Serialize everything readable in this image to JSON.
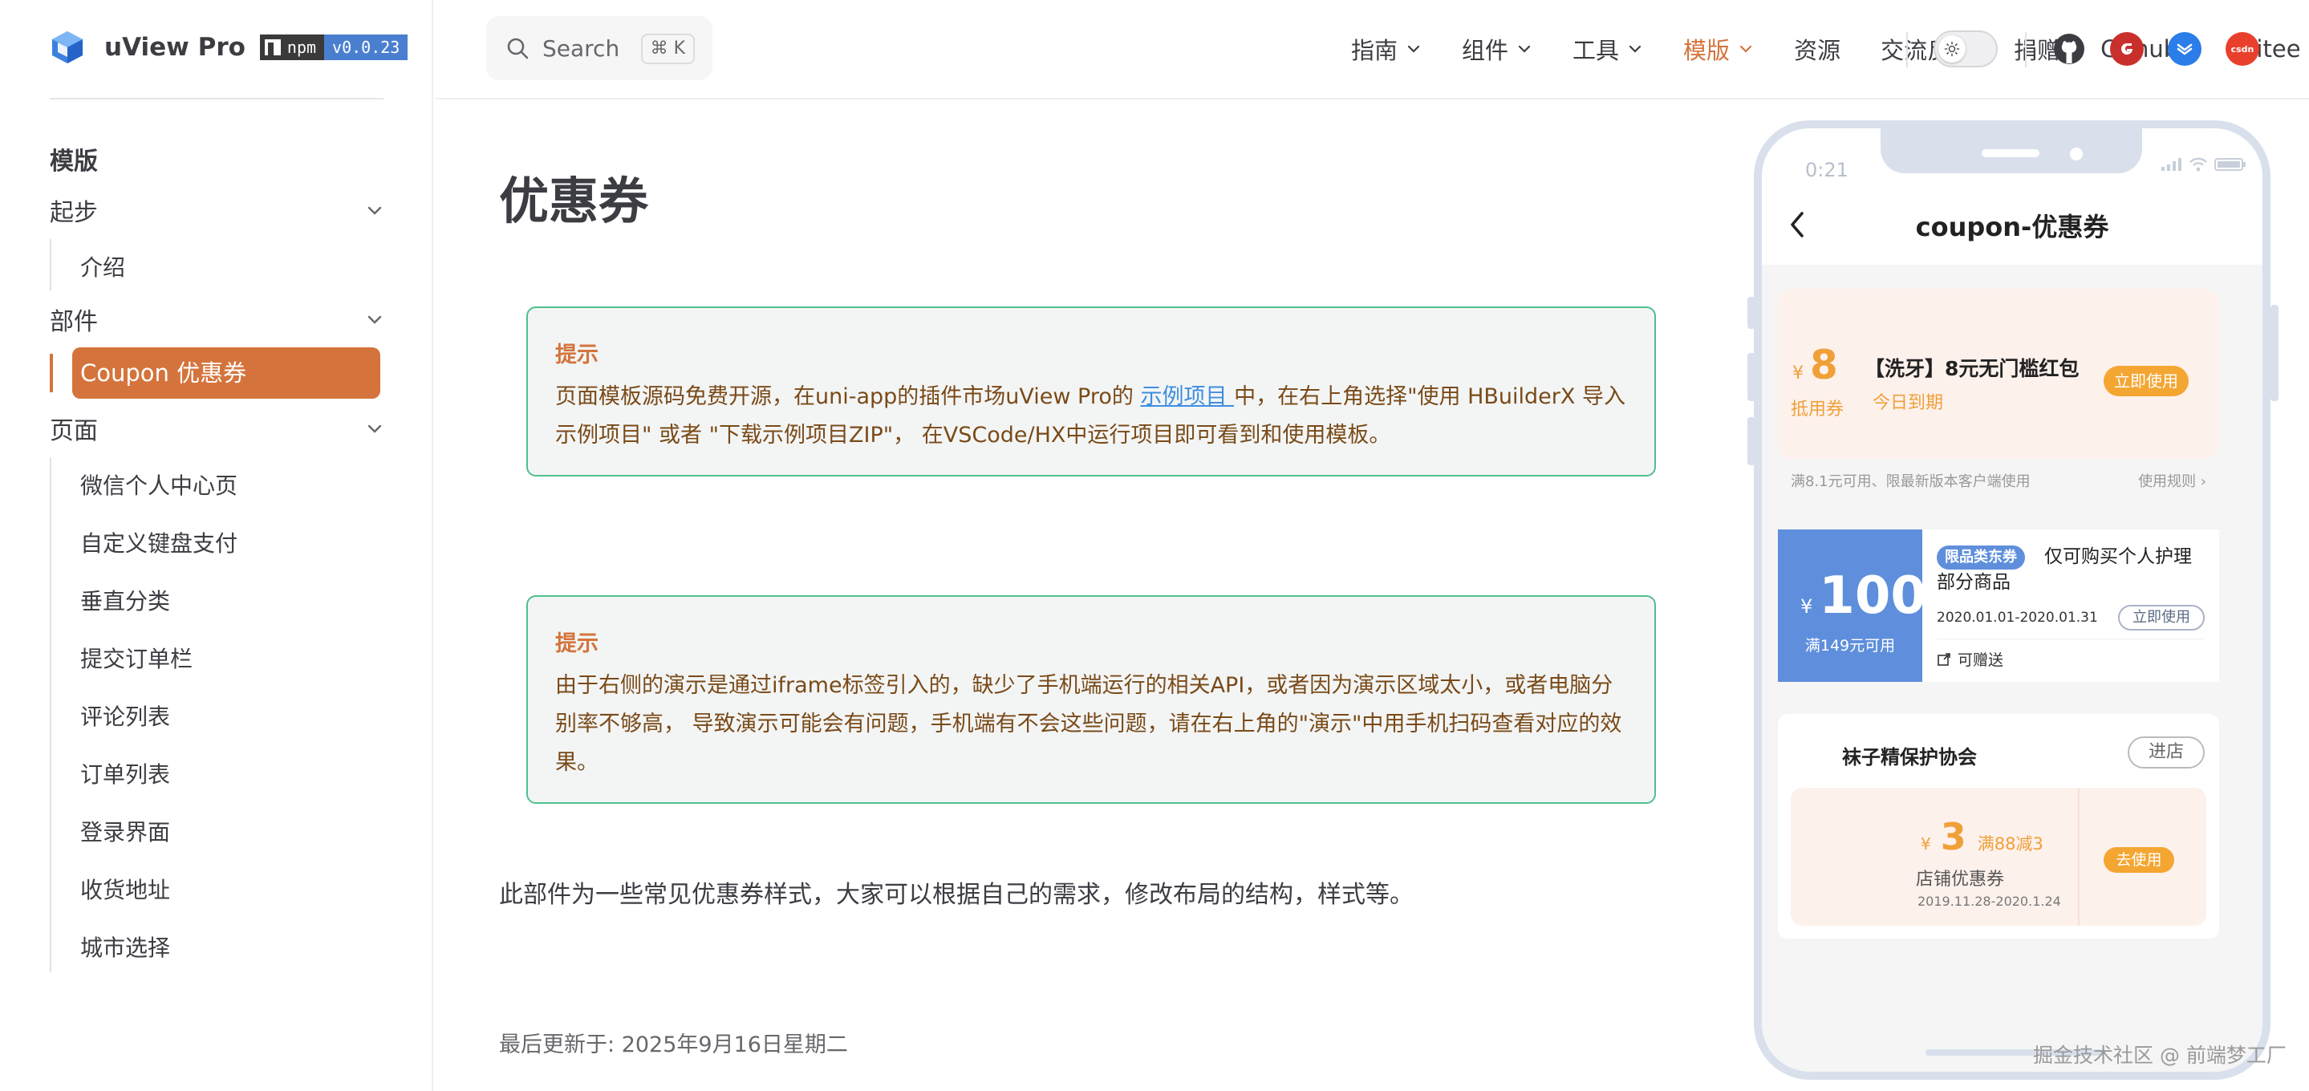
{
  "brand": {
    "name": "uView Pro",
    "npm_label": "npm",
    "version": "v0.0.23"
  },
  "colors": {
    "accent": "#d4743c",
    "tip_border": "#4fc08d",
    "link": "#3d8fe0",
    "coupon_orange": "#f0a039",
    "coupon_blue": "#5f8fdc"
  },
  "sidebar": {
    "section_title": "模版",
    "groups": [
      {
        "label": "起步",
        "items": [
          "介绍"
        ]
      },
      {
        "label": "部件",
        "items": [
          "Coupon 优惠券"
        ]
      },
      {
        "label": "页面",
        "items": [
          "微信个人中心页",
          "自定义键盘支付",
          "垂直分类",
          "提交订单栏",
          "评论列表",
          "订单列表",
          "登录界面",
          "收货地址",
          "城市选择"
        ]
      }
    ]
  },
  "search": {
    "placeholder": "Search",
    "shortcut": "⌘ K"
  },
  "nav": {
    "items": [
      {
        "label": "指南",
        "icon": "chevron-down-icon"
      },
      {
        "label": "组件",
        "icon": "chevron-down-icon"
      },
      {
        "label": "工具",
        "icon": "chevron-down-icon"
      },
      {
        "label": "模版",
        "icon": "chevron-down-icon",
        "active": true
      },
      {
        "label": "资源"
      },
      {
        "label": "交流反馈"
      },
      {
        "label": "捐赠"
      },
      {
        "label": "Github",
        "icon": "external-link-icon"
      },
      {
        "label": "Gitee",
        "icon": "external-link-icon"
      }
    ],
    "social": [
      "github-icon",
      "gitee-icon",
      "dcloud-icon",
      "csdn-icon"
    ],
    "csdn_label": "csdn"
  },
  "content": {
    "title": "优惠券",
    "tip1": {
      "title": "提示",
      "before_link": "页面模板源码免费开源，在uni-app的插件市场uView Pro的 ",
      "link": "示例项目 ",
      "after_link": "中，在右上角选择\"使用 HBuilderX 导入示例项目\" 或者 \"下载示例项目ZIP\"， 在VSCode/HX中运行项目即可看到和使用模板。"
    },
    "tip2": {
      "title": "提示",
      "body": "由于右侧的演示是通过iframe标签引入的，缺少了手机端运行的相关API，或者因为演示区域太小，或者电脑分别率不够高， 导致演示可能会有问题，手机端有不会这些问题，请在右上角的\"演示\"中用手机扫码查看对应的效果。"
    },
    "paragraph": "此部件为一些常见优惠券样式，大家可以根据自己的需求，修改布局的结构，样式等。",
    "last_updated_label": "最后更新于: ",
    "last_updated_value": "2025年9月16日星期二"
  },
  "phone": {
    "time": "0:21",
    "title": "coupon-优惠券",
    "coupon1": {
      "currency": "¥",
      "amount": "8",
      "label": "抵用券",
      "name": "【洗牙】8元无门槛红包",
      "expire": "今日到期",
      "button": "立即使用",
      "note": "满8.1元可用、限最新版本客户端使用",
      "rules": "使用规则",
      "rules_icon": "chevron-right-icon"
    },
    "coupon2": {
      "currency": "¥",
      "amount": "100",
      "condition": "满149元可用",
      "tag": "限品类东券",
      "desc": "仅可购买个人护理部分商品",
      "date": "2020.01.01-2020.01.31",
      "button": "立即使用",
      "gift": "可赠送"
    },
    "coupon3": {
      "shop": "袜子精保护协会",
      "enter": "进店",
      "currency": "¥",
      "amount": "3",
      "condition": "满88减3",
      "type": "店铺优惠券",
      "date": "2019.11.28-2020.1.24",
      "button": "去使用"
    }
  },
  "watermark": "掘金技术社区 @ 前端梦工厂"
}
